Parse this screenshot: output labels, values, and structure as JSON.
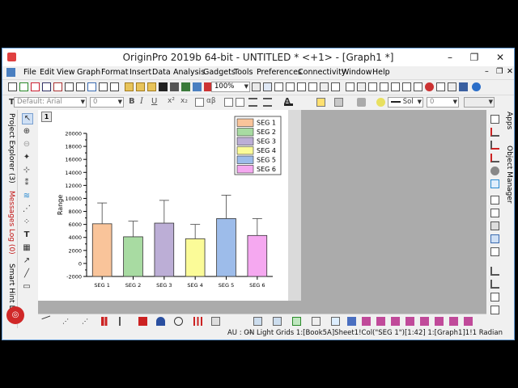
{
  "window": {
    "title": "OriginPro 2019b 64-bit - UNTITLED * <+1> - [Graph1 *]",
    "minimize": "–",
    "restore": "❐",
    "close": "✕"
  },
  "menu": [
    "File",
    "Edit",
    "View",
    "Graph",
    "Format",
    "Insert",
    "Data",
    "Analysis",
    "Gadgets",
    "Tools",
    "Preferences",
    "Connectivity",
    "Window",
    "Help"
  ],
  "toolbar": {
    "zoom_value": "100%",
    "font_name": "Default: Arial",
    "font_size": "0",
    "bold": "B",
    "italic": "I",
    "underline": "U",
    "superscript": "x²",
    "subscript": "x₂",
    "greek": "αβ",
    "line_style": "Sol",
    "line_width": "0"
  },
  "left_tabs": [
    "Project Explorer (3)",
    "Messages Log (0)",
    "Smart Hint Log"
  ],
  "right_tabs": [
    "Apps",
    "Object Manager"
  ],
  "graph": {
    "layer_number": "1"
  },
  "status": {
    "text": "AU : ON Light Grids 1:[Book5A]Sheet1!Col(\"SEG 1\")[1:42]  1:[Graph1]1!1  Radian"
  },
  "chart_data": {
    "type": "bar",
    "categories": [
      "SEG 1",
      "SEG 2",
      "SEG 3",
      "SEG 4",
      "SEG 5",
      "SEG 6"
    ],
    "values": [
      6100,
      4100,
      6200,
      3800,
      6900,
      4300
    ],
    "error_plus": [
      3200,
      2400,
      3500,
      2200,
      3600,
      2600
    ],
    "colors": [
      "#f9c49a",
      "#a8dba2",
      "#bcaed6",
      "#fbfb98",
      "#9dbcea",
      "#f5a8f0"
    ],
    "ylabel": "Range",
    "xlabel": "",
    "ylim": [
      -2000,
      20000
    ],
    "yticks": [
      -2000,
      0,
      2000,
      4000,
      6000,
      8000,
      10000,
      12000,
      14000,
      16000,
      18000,
      20000
    ],
    "legend": {
      "entries": [
        "SEG 1",
        "SEG 2",
        "SEG 3",
        "SEG 4",
        "SEG 5",
        "SEG 6"
      ],
      "placement": "top-right"
    },
    "grid": false
  }
}
